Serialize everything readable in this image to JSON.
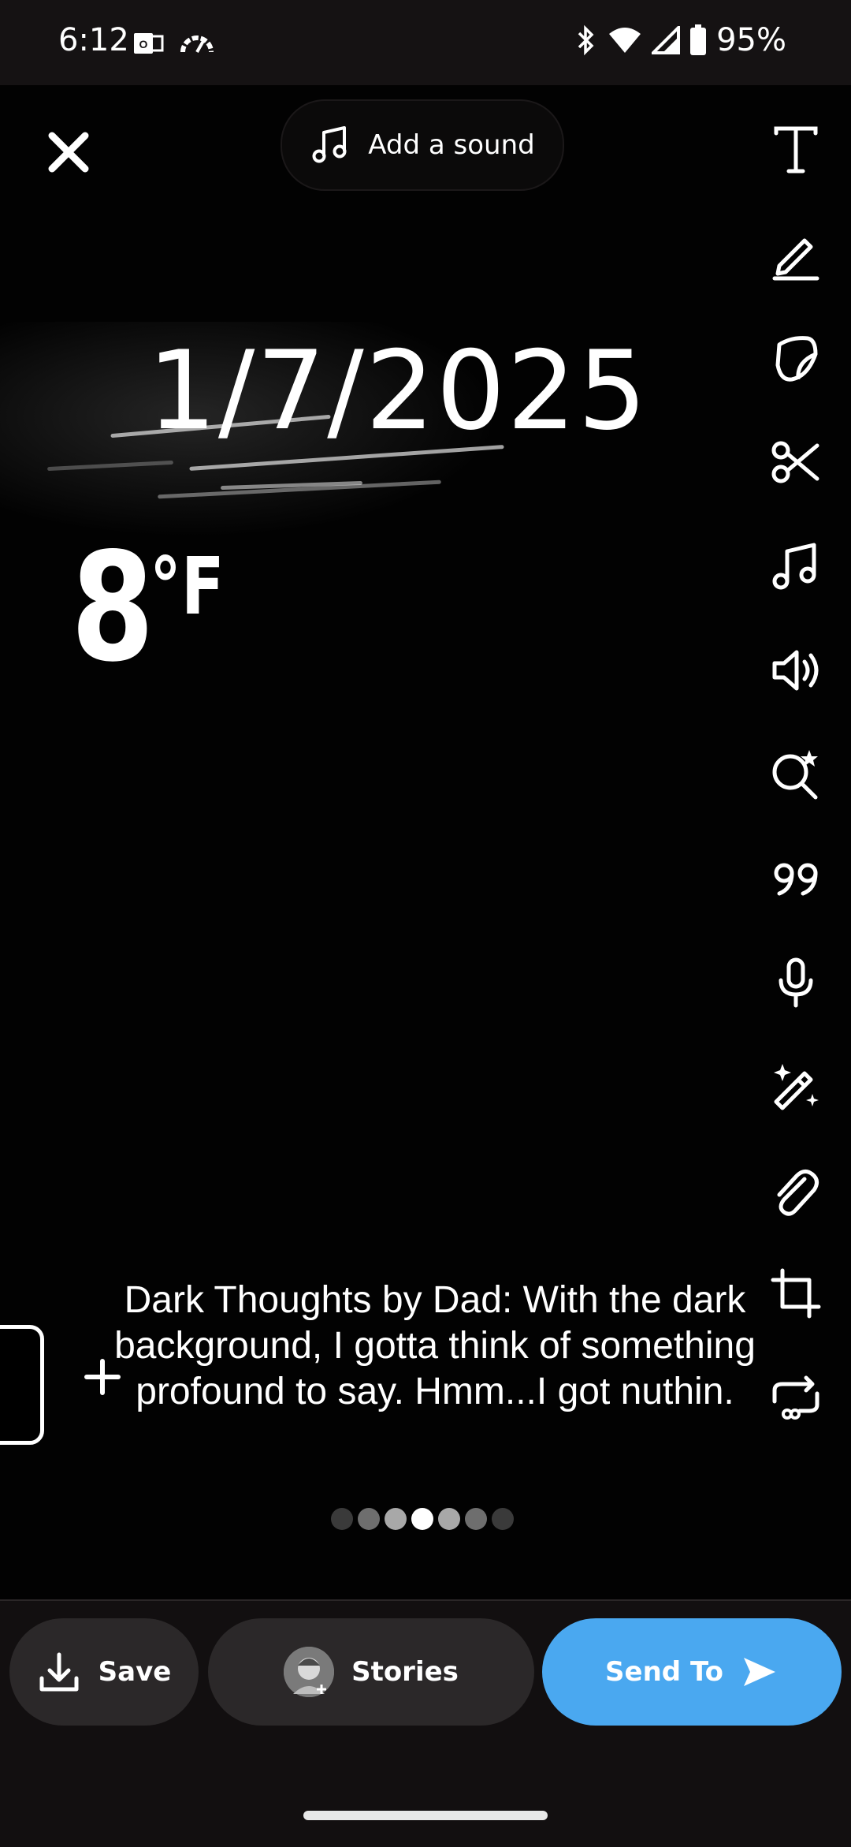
{
  "status_bar": {
    "time": "6:12",
    "battery": "95%"
  },
  "top": {
    "sound_label": "Add a sound"
  },
  "snap": {
    "date": "1/7/2025",
    "temperature_value": "8",
    "temperature_unit": "°F",
    "caption": "Dark Thoughts by Dad:  With the dark background, I gotta think of something profound to say.  Hmm...I got nuthin."
  },
  "toolbar": {
    "tools": [
      "text-icon",
      "pencil-icon",
      "sticker-icon",
      "scissors-icon",
      "music-icon",
      "speaker-icon",
      "lens-search-icon",
      "quote-icon",
      "microphone-icon",
      "magic-wand-icon",
      "paperclip-icon",
      "crop-icon",
      "loop-icon"
    ]
  },
  "carousel": {
    "dot_count": 7,
    "active_index": 3
  },
  "actions": {
    "save_label": "Save",
    "stories_label": "Stories",
    "send_label": "Send To"
  },
  "colors": {
    "send_button": "#4aa8f0",
    "pill_background": "#2b2829"
  }
}
